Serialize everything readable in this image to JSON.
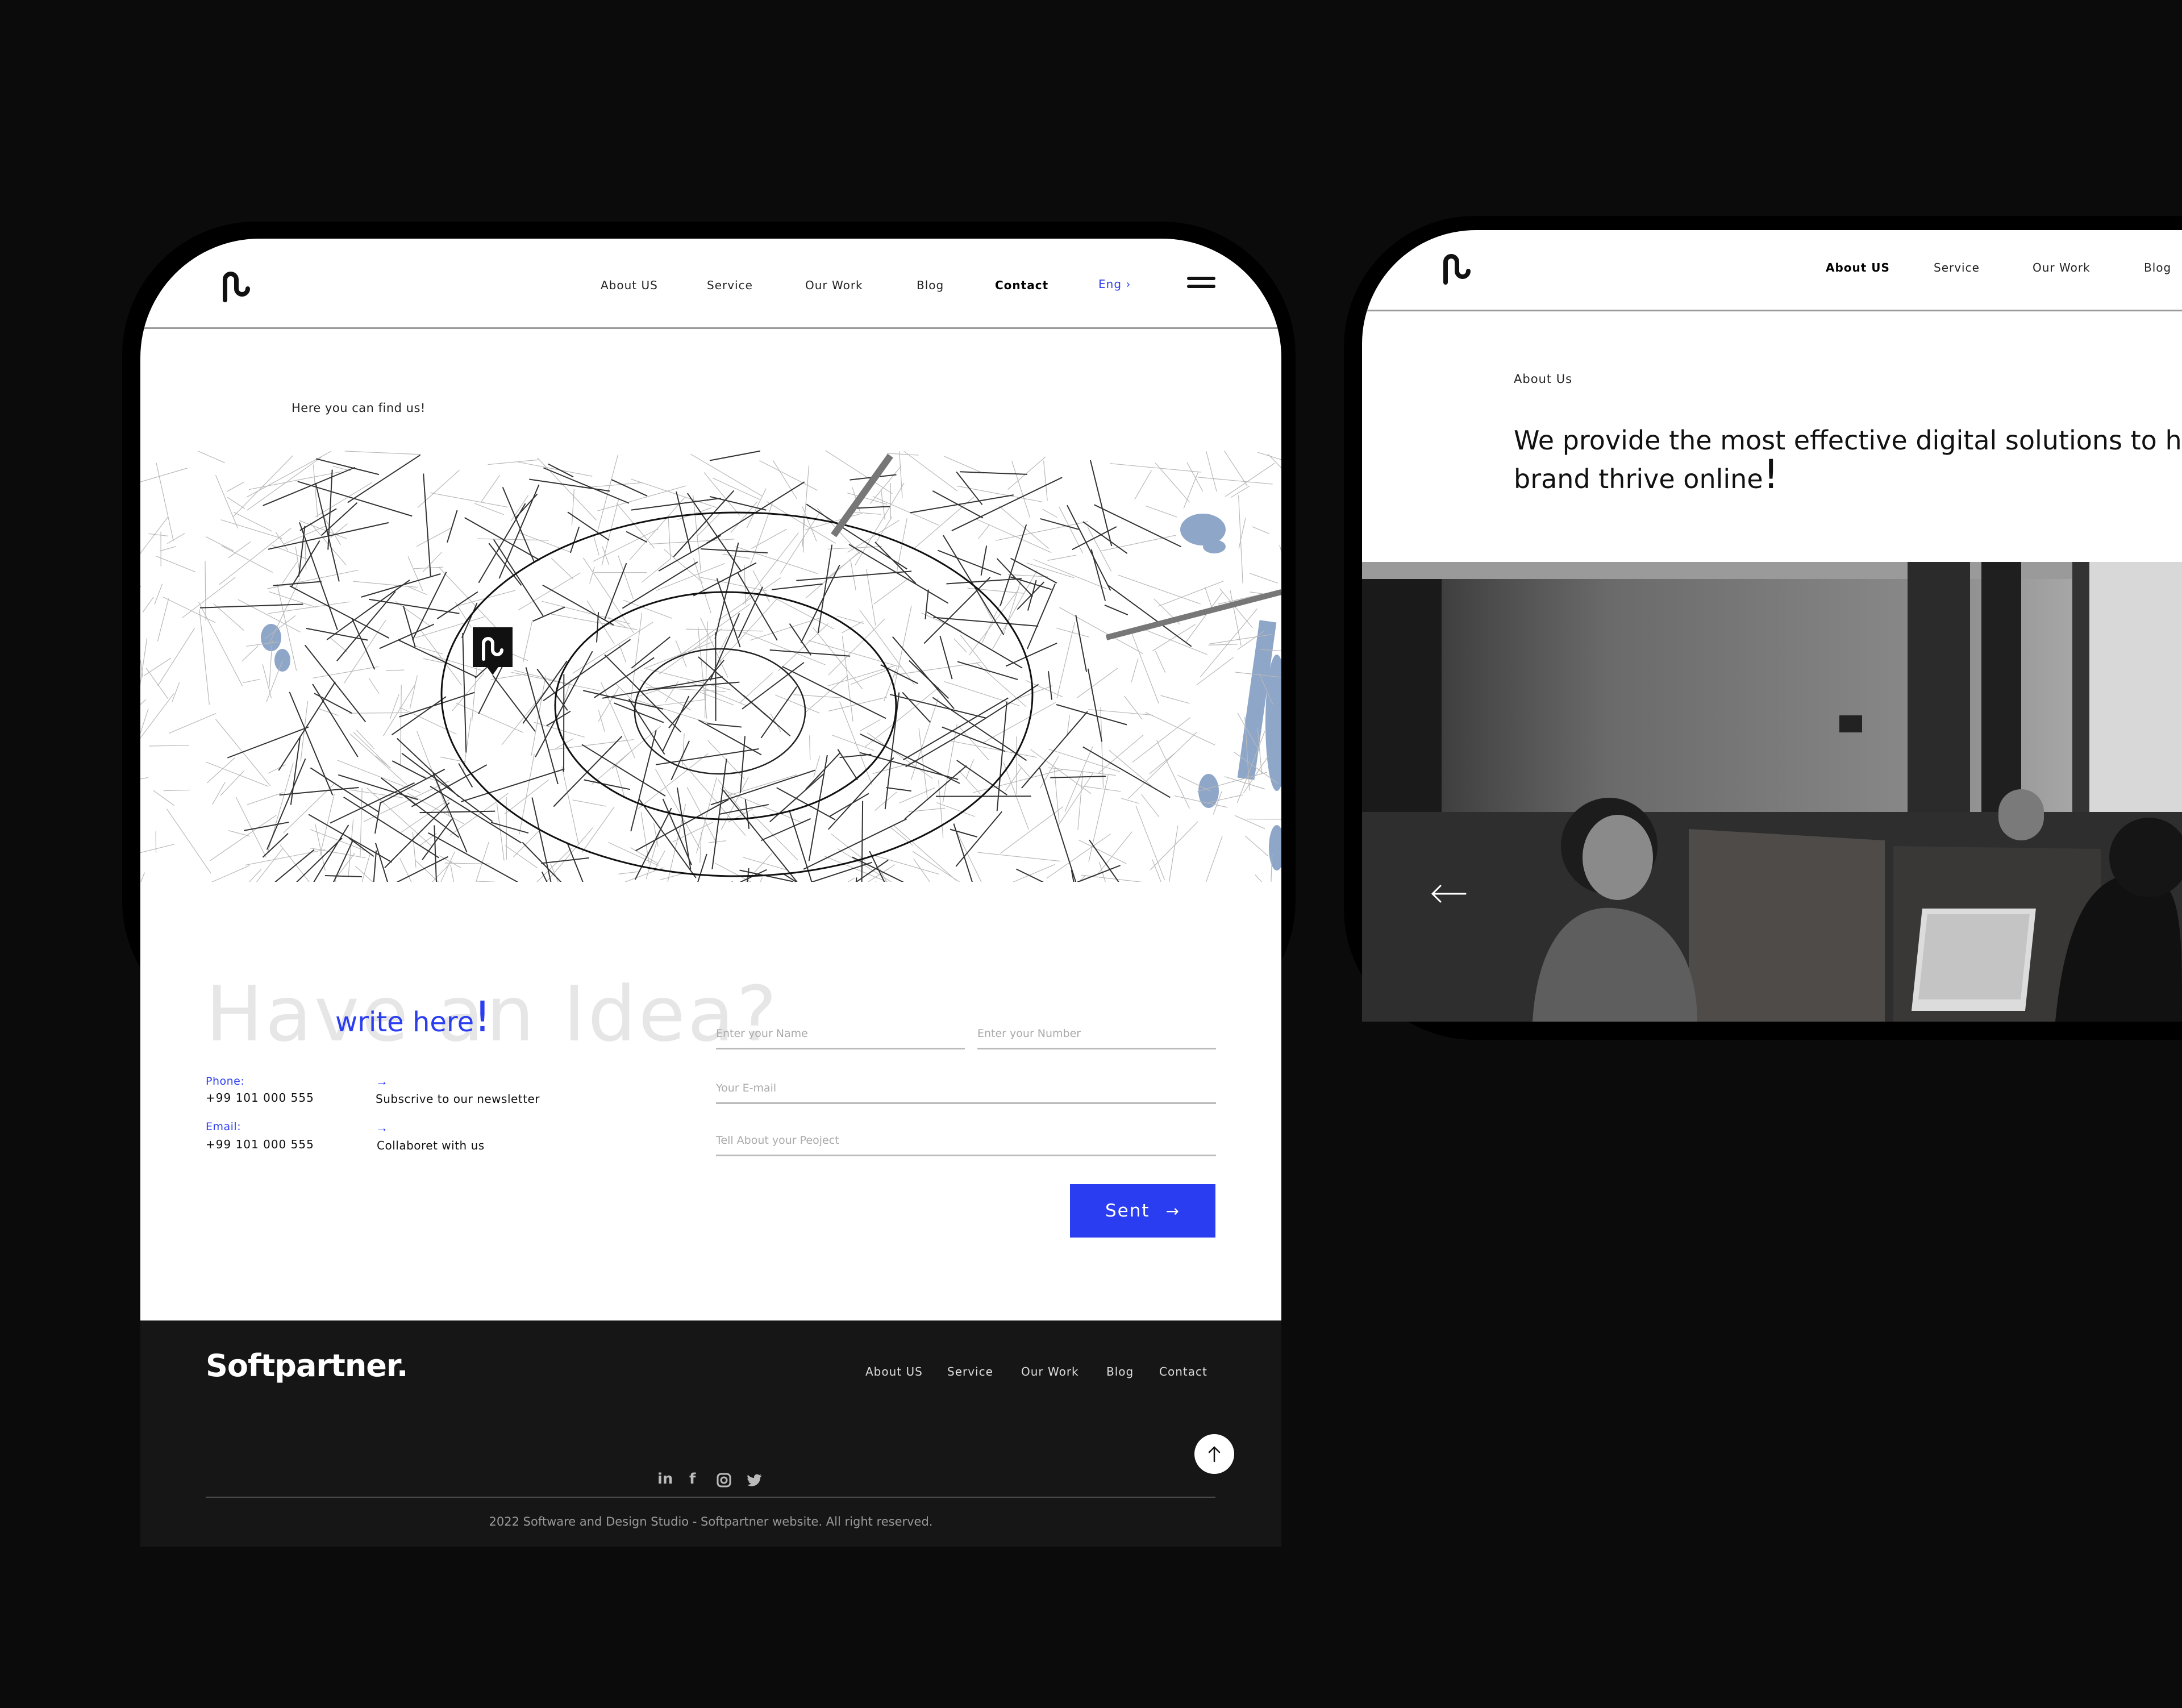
{
  "colors": {
    "accent": "#2b3df0",
    "page_bg": "#0b0b0b",
    "footer_bg": "#161616"
  },
  "contact_page": {
    "nav": {
      "items": [
        "About US",
        "Service",
        "Our Work",
        "Blog",
        "Contact"
      ],
      "active": "Contact",
      "language": "Eng ›"
    },
    "map_section": {
      "label": "Here you can find us!"
    },
    "contact": {
      "ghost_heading": "Have an Idea?",
      "write_heading": "write here",
      "write_mark": "!",
      "phone_label": "Phone:",
      "phone_value": "+99 101 000 555",
      "email_label": "Email:",
      "email_value": "+99 101 000 555",
      "arrow": "→",
      "link1": "Subscrive to our newsletter",
      "link2": "Collaboret with us"
    },
    "form": {
      "name_placeholder": "Enter your Name",
      "number_placeholder": "Enter your Number",
      "email_placeholder": "Your E-mail",
      "project_placeholder": "Tell About your Peoject",
      "submit_label": "Sent",
      "submit_arrow": "→"
    },
    "footer": {
      "brand": "Softpartner.",
      "nav": [
        "About US",
        "Service",
        "Our Work",
        "Blog",
        "Contact"
      ],
      "social": [
        "in",
        "f",
        "instagram-icon",
        "twitter-icon"
      ],
      "copyright": "2022 Software and Design Studio - Softpartner website. All right reserved."
    }
  },
  "about_page": {
    "nav": {
      "items": [
        "About US",
        "Service",
        "Our Work",
        "Blog"
      ],
      "active": "About US"
    },
    "section_label": "About Us",
    "headline_line1": "We provide the most effective digital solutions to h",
    "headline_line2": "brand thrive online",
    "headline_mark": "!",
    "prev_arrow": "←"
  }
}
